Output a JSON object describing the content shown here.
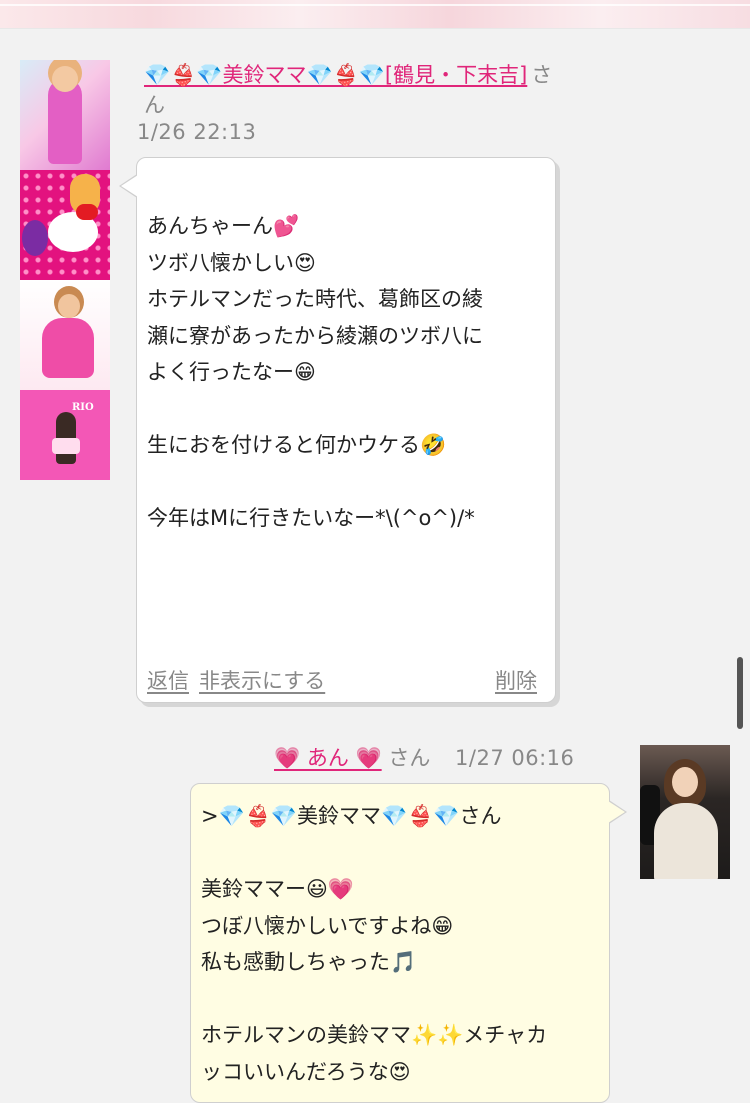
{
  "comments": [
    {
      "user_name": "💎👙💎美鈴ママ💎👙💎[鶴見・下末吉]",
      "name_suffix": "さん",
      "timestamp": "1/26 22:13",
      "body_lines": [
        "あんちゃーん💕",
        "ツボ八懐かしい😍",
        "ホテルマンだった時代、葛飾区の綾",
        "瀬に寮があったから綾瀬のツボ八に",
        "よく行ったなー😁",
        "",
        "生におを付けると何かウケる🤣",
        "",
        "今年はMに行きたいなー*\\(^o^)/*"
      ],
      "actions": {
        "reply": "返信",
        "hide": "非表示にする",
        "delete": "削除"
      }
    },
    {
      "user_name": "💗 あん 💗",
      "name_suffix": "さん",
      "timestamp": "1/27 06:16",
      "body_lines": [
        ">💎👙💎美鈴ママ💎👙💎さん",
        "",
        "美鈴ママー😃💗",
        "つぼ八懐かしいですよね😁",
        "私も感動しちゃった🎵",
        "",
        "ホテルマンの美鈴ママ✨✨メチャカ",
        "ッコいいんだろうな😍"
      ]
    }
  ],
  "avatar_stamp_text": "RIO",
  "colors": {
    "name_link": "#e0267a",
    "meta_text": "#888888",
    "bubble_own": "#fffde3",
    "bubble_other": "#ffffff"
  }
}
